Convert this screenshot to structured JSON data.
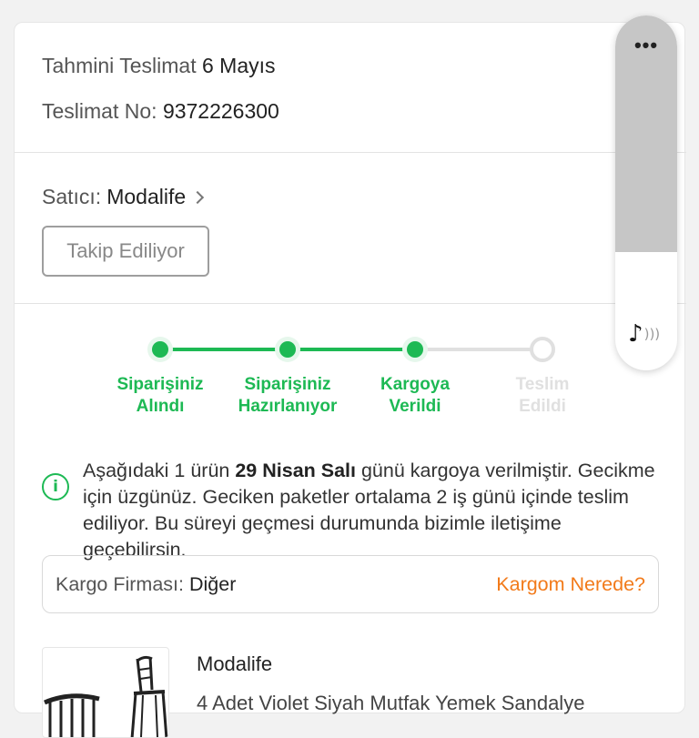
{
  "delivery": {
    "estimate_label": "Tahmini Teslimat",
    "estimate_value": "6 Mayıs",
    "number_label": "Teslimat No:",
    "number_value": "9372226300"
  },
  "seller": {
    "label": "Satıcı:",
    "name": "Modalife",
    "follow_button": "Takip Ediliyor"
  },
  "steps": [
    {
      "line1": "Siparişiniz",
      "line2": "Alındı",
      "active": true
    },
    {
      "line1": "Siparişiniz",
      "line2": "Hazırlanıyor",
      "active": true
    },
    {
      "line1": "Kargoya",
      "line2": "Verildi",
      "active": true
    },
    {
      "line1": "Teslim",
      "line2": "Edildi",
      "active": false
    }
  ],
  "info": {
    "icon": "info-icon",
    "prefix": "Aşağıdaki 1 ürün ",
    "date": "29 Nisan Salı",
    "suffix": " günü kargoya verilmiştir. Gecikme için üzgünüz. Geciken paketler ortalama 2 iş günü içinde teslim ediliyor. Bu süreyi geçmesi durumunda bizimle iletişime geçebilirsin."
  },
  "cargo": {
    "label": "Kargo Firması:",
    "value": "Diğer",
    "link": "Kargom Nerede?"
  },
  "product": {
    "seller": "Modalife",
    "name": "4 Adet Violet Siyah Mutfak Yemek Sandalye"
  },
  "float_panel": {
    "more": "•••",
    "icons": [
      "more-icon",
      "music-note-icon"
    ]
  },
  "colors": {
    "accent_green": "#1db954",
    "accent_orange": "#f27a1a"
  }
}
